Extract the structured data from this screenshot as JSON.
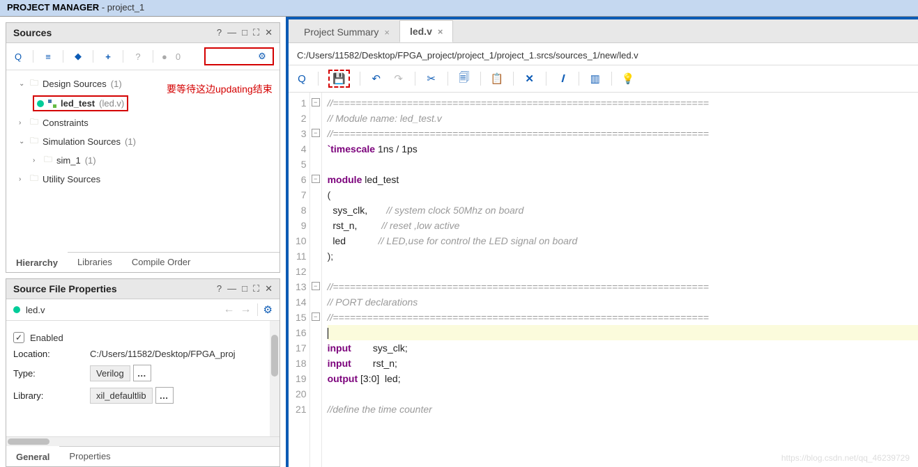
{
  "titlebar": {
    "app": "PROJECT MANAGER",
    "proj": "- project_1"
  },
  "sources": {
    "title": "Sources",
    "help": "?",
    "count_badge": "0",
    "annotation": "要等待这边updating结束",
    "tree": {
      "design": "Design Sources",
      "design_cnt": "(1)",
      "led_test": "led_test",
      "led_file": "(led.v)",
      "constraints": "Constraints",
      "sim": "Simulation Sources",
      "sim_cnt": "(1)",
      "sim1": "sim_1",
      "sim1_cnt": "(1)",
      "util": "Utility Sources"
    },
    "tabs": {
      "hierarchy": "Hierarchy",
      "libraries": "Libraries",
      "compile": "Compile Order"
    }
  },
  "props": {
    "title": "Source File Properties",
    "file": "led.v",
    "enabled": "Enabled",
    "loc_label": "Location:",
    "loc_val": "C:/Users/11582/Desktop/FPGA_proj",
    "type_label": "Type:",
    "type_val": "Verilog",
    "lib_label": "Library:",
    "lib_val": "xil_defaultlib",
    "tabs": {
      "general": "General",
      "properties": "Properties"
    }
  },
  "editor": {
    "tab_summary": "Project Summary",
    "tab_file": "led.v",
    "path": "C:/Users/11582/Desktop/FPGA_project/project_1/project_1.srcs/sources_1/new/led.v",
    "lines": [
      {
        "n": 1,
        "cls": "cm-gray",
        "t": "//=================================================================="
      },
      {
        "n": 2,
        "cls": "cm-gray",
        "t": "// Module name: led_test.v"
      },
      {
        "n": 3,
        "cls": "cm-gray",
        "t": "//=================================================================="
      },
      {
        "n": 4,
        "html": "<span class='cm-kw'>`timescale</span> <span class='cm-id'>1ns / 1ps</span>"
      },
      {
        "n": 5,
        "t": ""
      },
      {
        "n": 6,
        "html": "<span class='cm-kw'>module</span> <span class='cm-id'>led_test</span>"
      },
      {
        "n": 7,
        "t": "("
      },
      {
        "n": 8,
        "html": "  <span class='cm-id'>sys_clk,</span>       <span class='cm-gray'>// system clock 50Mhz on board</span>"
      },
      {
        "n": 9,
        "html": "  <span class='cm-id'>rst_n,</span>         <span class='cm-gray'>// reset ,low active</span>"
      },
      {
        "n": 10,
        "html": "  <span class='cm-id'>led</span>            <span class='cm-gray'>// LED,use for control the LED signal on board</span>"
      },
      {
        "n": 11,
        "t": ");"
      },
      {
        "n": 12,
        "t": ""
      },
      {
        "n": 13,
        "cls": "cm-gray",
        "t": "//=================================================================="
      },
      {
        "n": 14,
        "cls": "cm-gray",
        "t": "// PORT declarations"
      },
      {
        "n": 15,
        "cls": "cm-gray",
        "t": "//=================================================================="
      },
      {
        "n": 16,
        "hl": true,
        "t": ""
      },
      {
        "n": 17,
        "html": "<span class='cm-kw'>input</span>        <span class='cm-id'>sys_clk;</span>"
      },
      {
        "n": 18,
        "html": "<span class='cm-kw'>input</span>        <span class='cm-id'>rst_n;</span>"
      },
      {
        "n": 19,
        "html": "<span class='cm-kw'>output</span> <span class='cm-id'>[3:0]  led;</span>"
      },
      {
        "n": 20,
        "t": ""
      },
      {
        "n": 21,
        "cls": "cm-gray",
        "t": "//define the time counter"
      }
    ]
  },
  "watermark": "https://blog.csdn.net/qq_46239729"
}
